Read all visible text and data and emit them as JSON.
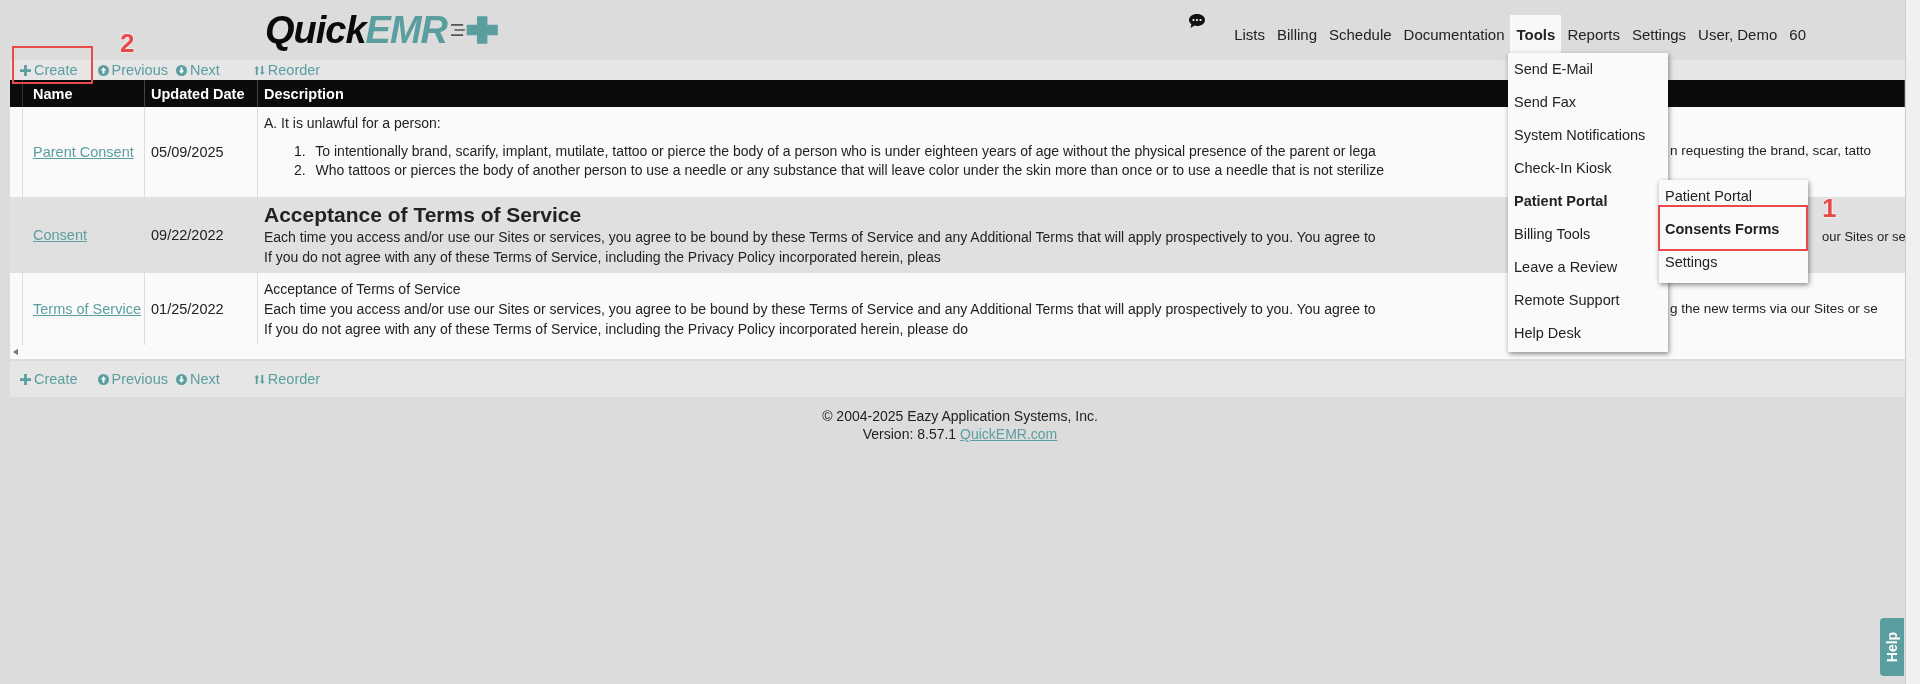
{
  "logo": {
    "part1": "Quick",
    "part2": "EMR"
  },
  "nav": [
    {
      "label": "Lists",
      "selected": false
    },
    {
      "label": "Billing",
      "selected": false
    },
    {
      "label": "Schedule",
      "selected": false
    },
    {
      "label": "Documentation",
      "selected": false
    },
    {
      "label": "Tools",
      "selected": true
    },
    {
      "label": "Reports",
      "selected": false
    },
    {
      "label": "Settings",
      "selected": false
    },
    {
      "label": "User, Demo",
      "selected": false
    },
    {
      "label": "60",
      "selected": false
    }
  ],
  "top_toolbar": [
    {
      "kind": "create",
      "label": "Create",
      "annotation": "2"
    },
    {
      "kind": "previous",
      "label": "Previous"
    },
    {
      "kind": "next",
      "label": "Next"
    },
    {
      "kind": "reorder",
      "label": "Reorder"
    }
  ],
  "bottom_toolbar": [
    {
      "kind": "create",
      "label": "Create"
    },
    {
      "kind": "previous",
      "label": "Previous"
    },
    {
      "kind": "next",
      "label": "Next"
    },
    {
      "kind": "reorder",
      "label": "Reorder"
    }
  ],
  "table": {
    "columns": [
      "Name",
      "Updated Date",
      "Description"
    ],
    "rows": [
      {
        "name": "Parent Consent",
        "date": "05/09/2025",
        "shaded": false,
        "lines": [
          {
            "kind": "text",
            "left": "A. It is unlawful for a person:"
          },
          {
            "kind": "item",
            "marker": "1.",
            "left": "To intentionally brand, scarify, implant, mutilate, tattoo or pierce the body of a person who is under eighteen years of age without the physical presence of the parent or lega",
            "right": "n requesting the brand, scar, tatto",
            "past_submenu": false
          },
          {
            "kind": "item",
            "marker": "2.",
            "left": "Who tattoos or pierces the body of another person to use a needle or any substance that will leave color under the skin more than once or to use a needle that is not sterilize"
          }
        ]
      },
      {
        "name": "Consent",
        "date": "09/22/2022",
        "shaded": true,
        "lines": [
          {
            "kind": "heading",
            "left": "Acceptance of Terms of Service"
          },
          {
            "kind": "text",
            "left": "Each time you access and/or use our Sites or services, you agree to be bound by these Terms of Service and any Additional Terms that will apply prospectively to you. You agree to",
            "right": "our Sites or se",
            "past_submenu": true
          },
          {
            "kind": "text",
            "left": "If you do not agree with any of these Terms of Service, including the Privacy Policy incorporated herein, pleas"
          }
        ]
      },
      {
        "name": "Terms of Service",
        "date": "01/25/2022",
        "shaded": false,
        "lines": [
          {
            "kind": "text",
            "left": "Acceptance of Terms of Service"
          },
          {
            "kind": "text",
            "left": "Each time you access and/or use our Sites or services, you agree to be bound by these Terms of Service and any Additional Terms that will apply prospectively to you. You agree to",
            "right": "g the new terms via our Sites or se",
            "past_submenu": false
          },
          {
            "kind": "text",
            "left": "If you do not agree with any of these Terms of Service, including the Privacy Policy incorporated herein, please do"
          }
        ]
      }
    ]
  },
  "tools_menu": [
    {
      "label": "Send E-Mail",
      "expanded": false
    },
    {
      "label": "Send Fax",
      "expanded": false
    },
    {
      "label": "System Notifications",
      "expanded": false
    },
    {
      "label": "Check-In Kiosk",
      "expanded": false
    },
    {
      "label": "Patient Portal",
      "expanded": true
    },
    {
      "label": "Billing Tools",
      "expanded": false
    },
    {
      "label": "Leave a Review",
      "expanded": false
    },
    {
      "label": "Remote Support",
      "expanded": false
    },
    {
      "label": "Help Desk",
      "expanded": false
    }
  ],
  "submenu": [
    {
      "label": "Patient Portal",
      "selected": false
    },
    {
      "label": "Consents Forms",
      "selected": true,
      "annotation": "1"
    },
    {
      "label": "Settings",
      "selected": false
    }
  ],
  "footer": {
    "copyright": "© 2004-2025 Eazy Application Systems, Inc.",
    "version": "Version: 8.57.1",
    "link": "QuickEMR.com"
  },
  "help_tab": "Help"
}
